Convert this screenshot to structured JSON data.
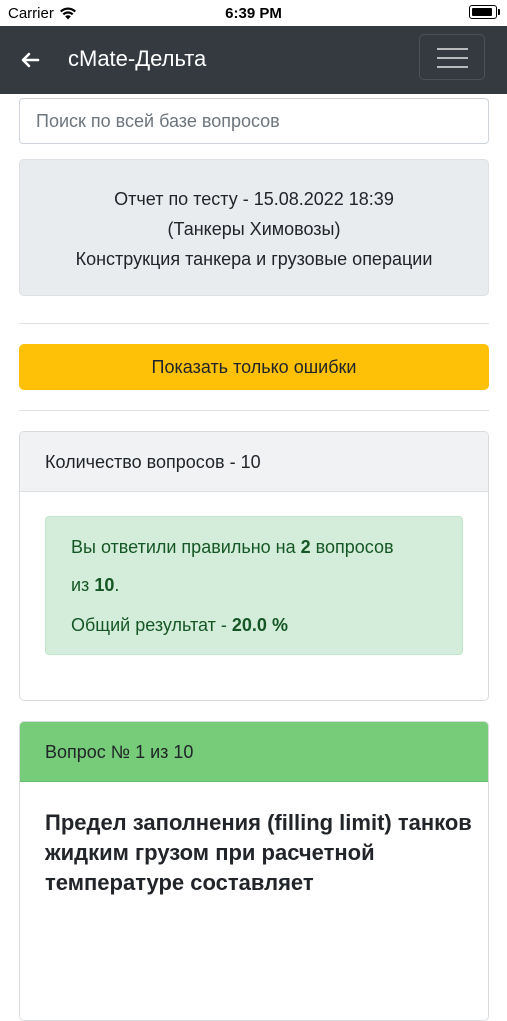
{
  "status_bar": {
    "carrier": "Carrier",
    "time": "6:39 PM"
  },
  "navbar": {
    "title": "cMate-Дельта"
  },
  "search": {
    "placeholder": "Поиск по всей базе вопросов"
  },
  "report": {
    "line1": "Отчет по тесту - 15.08.2022 18:39",
    "line2": "(Танкеры Химовозы)",
    "line3": "Конструкция танкера и грузовые операции"
  },
  "filter_button": {
    "label": "Показать только ошибки"
  },
  "stats": {
    "header": "Количество вопросов - 10",
    "answered_prefix": "Вы ответили правильно на",
    "correct_count": "2",
    "answered_suffix": "вопросов",
    "of_prefix": "из",
    "total": "10",
    "of_suffix": ".",
    "result_label": "Общий результат -",
    "result_value": "20.0 %"
  },
  "question": {
    "header": "Вопрос № 1 из 10",
    "text": "Предел заполнения (filling limit) танков жидким грузом при расчетной температуре составляет"
  },
  "colors": {
    "navbar": "#343a40",
    "warning": "#ffc107",
    "success_bg": "#d4edda",
    "success_text": "#155724",
    "question_header": "#76cc78"
  }
}
